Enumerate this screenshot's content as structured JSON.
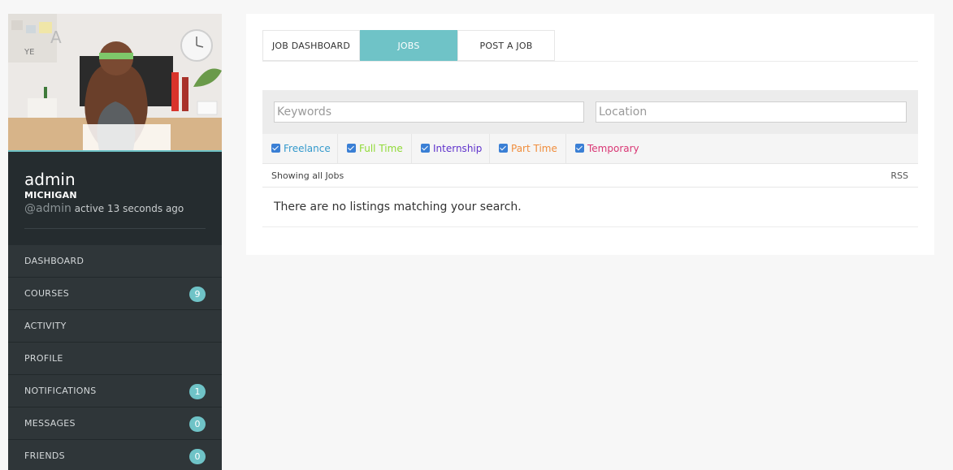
{
  "profile": {
    "name": "admin",
    "location": "MICHIGAN",
    "handle": "@admin",
    "activity": "active 13 seconds ago"
  },
  "menu": [
    {
      "label": "DASHBOARD",
      "badge": ""
    },
    {
      "label": "COURSES",
      "badge": "9"
    },
    {
      "label": "ACTIVITY",
      "badge": ""
    },
    {
      "label": "PROFILE",
      "badge": ""
    },
    {
      "label": "NOTIFICATIONS",
      "badge": "1"
    },
    {
      "label": "MESSAGES",
      "badge": "0"
    },
    {
      "label": "FRIENDS",
      "badge": "0"
    }
  ],
  "tabs": [
    {
      "label": "JOB DASHBOARD",
      "active": false
    },
    {
      "label": "JOBS",
      "active": true
    },
    {
      "label": "POST A JOB",
      "active": false
    }
  ],
  "search": {
    "keywords_placeholder": "Keywords",
    "location_placeholder": "Location"
  },
  "job_types": [
    {
      "label": "Freelance",
      "color": "#3399cc",
      "checked": true
    },
    {
      "label": "Full Time",
      "color": "#90da36",
      "checked": true
    },
    {
      "label": "Internship",
      "color": "#6033cc",
      "checked": true
    },
    {
      "label": "Part Time",
      "color": "#f08d3c",
      "checked": true
    },
    {
      "label": "Temporary",
      "color": "#d93674",
      "checked": true
    }
  ],
  "listing": {
    "showing": "Showing all Jobs",
    "rss": "RSS",
    "empty": "There are no listings matching your search."
  },
  "colors": {
    "accent": "#6fc3c7",
    "sidebar_bg": "#252c2f"
  }
}
